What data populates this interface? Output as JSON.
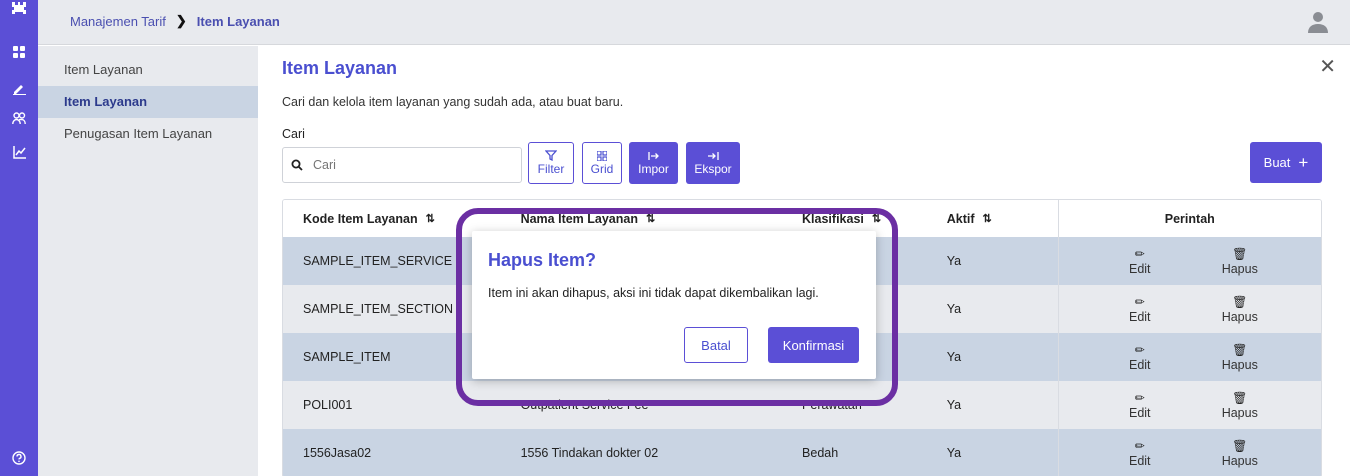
{
  "breadcrumb": {
    "parent": "Manajemen Tarif",
    "separator": "❯",
    "current": "Item Layanan"
  },
  "rail": {
    "icons": [
      "logo-icon",
      "grid-icon",
      "edit-icon",
      "users-icon",
      "chart-icon",
      "help-icon"
    ]
  },
  "subnav": {
    "section": "Item Layanan",
    "items": [
      {
        "label": "Item Layanan",
        "active": true
      },
      {
        "label": "Penugasan Item Layanan",
        "active": false
      }
    ]
  },
  "page": {
    "title": "Item Layanan",
    "description": "Cari dan kelola item layanan yang sudah ada, atau buat baru.",
    "search_label": "Cari",
    "search_placeholder": "Cari"
  },
  "toolbar": {
    "filter": "Filter",
    "grid": "Grid",
    "impor": "Impor",
    "ekspor": "Ekspor",
    "buat": "Buat",
    "buat_plus": "+"
  },
  "table": {
    "headers": {
      "kode": "Kode Item Layanan",
      "nama": "Nama Item Layanan",
      "klasifikasi": "Klasifikasi",
      "aktif": "Aktif",
      "perintah": "Perintah"
    },
    "sort_glyph": "⇅",
    "edit_label": "Edit",
    "hapus_label": "Hapus",
    "rows": [
      {
        "kode": "SAMPLE_ITEM_SERVICE",
        "nama": "",
        "klasifikasi": "",
        "aktif": "Ya"
      },
      {
        "kode": "SAMPLE_ITEM_SECTION",
        "nama": "",
        "klasifikasi": "",
        "aktif": "Ya"
      },
      {
        "kode": "SAMPLE_ITEM",
        "nama": "",
        "klasifikasi": "",
        "aktif": "Ya"
      },
      {
        "kode": "POLI001",
        "nama": "Outpatient Service Fee",
        "klasifikasi": "Perawatan",
        "aktif": "Ya"
      },
      {
        "kode": "1556Jasa02",
        "nama": "1556 Tindakan dokter 02",
        "klasifikasi": "Bedah",
        "aktif": "Ya"
      }
    ]
  },
  "modal": {
    "title": "Hapus Item?",
    "body": "Item ini akan dihapus, aksi ini tidak dapat dikembalikan lagi.",
    "cancel": "Batal",
    "confirm": "Konfirmasi"
  },
  "colors": {
    "accent": "#5b4fd6",
    "title": "#4a4fd0",
    "highlight_ring": "#6b2fa3",
    "row_alt": "#c9d4e3"
  }
}
